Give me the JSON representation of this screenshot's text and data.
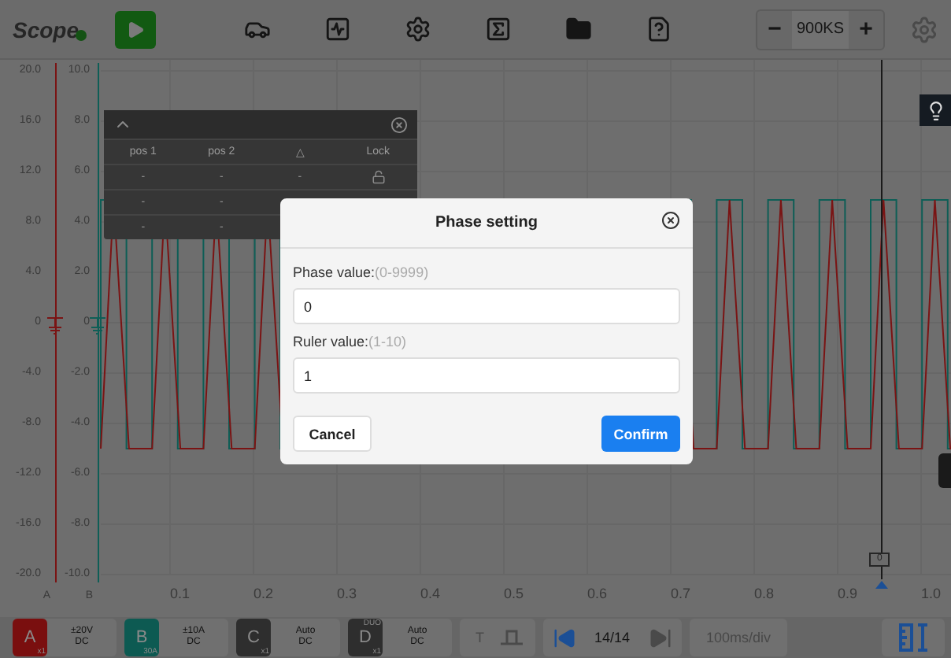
{
  "toolbar": {
    "title": "Scope",
    "running": false,
    "zoom": {
      "minus": "−",
      "value": "900KS",
      "plus": "+"
    }
  },
  "axes": [
    {
      "name": "A",
      "color": "#7a1414",
      "ticks": [
        "20.0",
        "16.0",
        "12.0",
        "8.0",
        "4.0",
        "0",
        "-4.0",
        "-8.0",
        "-12.0",
        "-16.0",
        "-20.0"
      ]
    },
    {
      "name": "B",
      "color": "#0e5e56",
      "ticks": [
        "10.0",
        "8.0",
        "6.0",
        "4.0",
        "2.0",
        "0",
        "-2.0",
        "-4.0",
        "-6.0",
        "-8.0",
        "-10.0"
      ]
    }
  ],
  "x_ticks": [
    "0.1",
    "0.2",
    "0.3",
    "0.4",
    "0.5",
    "0.6",
    "0.7",
    "0.8",
    "0.9",
    "1.0"
  ],
  "cursor_marker": "0",
  "cursor_panel": {
    "columns": [
      "pos 1",
      "pos 2",
      "△",
      "Lock"
    ],
    "rows": [
      {
        "cells": [
          "-",
          "-",
          "-"
        ],
        "locked": false
      },
      {
        "cells": [
          "-",
          "-"
        ]
      },
      {
        "cells": [
          "-",
          "-"
        ]
      }
    ]
  },
  "dialog": {
    "title": "Phase setting",
    "fields": [
      {
        "label": "Phase value:",
        "range": "(0-9999)",
        "value": "0"
      },
      {
        "label": "Ruler value:",
        "range": "(1-10)",
        "value": "1"
      }
    ],
    "cancel": "Cancel",
    "confirm": "Confirm"
  },
  "channels": [
    {
      "letter": "A",
      "probe": "x1",
      "range": "±20V",
      "coupling": "DC",
      "color": "#7a0f0f"
    },
    {
      "letter": "B",
      "probe": "30A",
      "range": "±10A",
      "coupling": "DC",
      "color": "#0d5a52"
    },
    {
      "letter": "C",
      "probe": "x1",
      "range": "Auto",
      "coupling": "DC",
      "color": "#2e2e2e"
    },
    {
      "letter": "D",
      "probe": "x1",
      "tag": "DUO",
      "range": "Auto",
      "coupling": "DC",
      "color": "#2e2e2e"
    }
  ],
  "trigger": {
    "label": "T"
  },
  "frames": "14/14",
  "timebase": "100ms/div"
}
